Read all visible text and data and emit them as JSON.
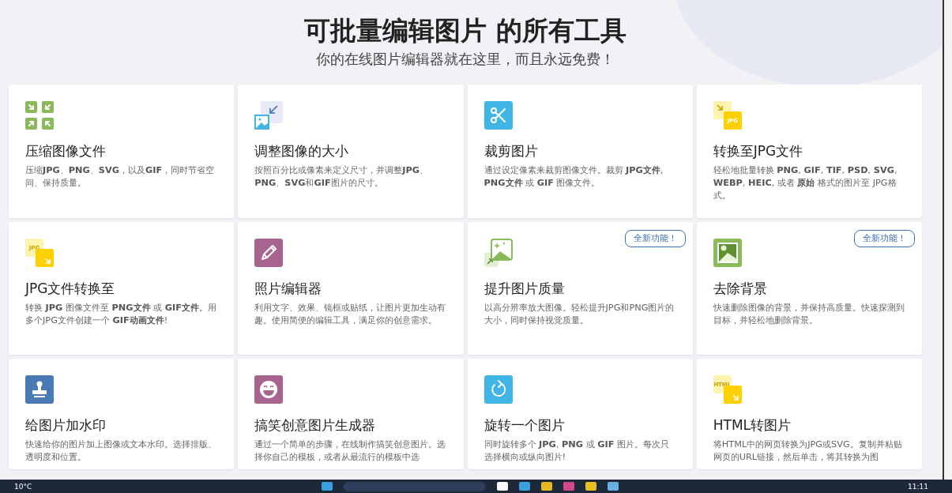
{
  "header": {
    "title": "可批量编辑图片 的所有工具",
    "subtitle": "你的在线图片编辑器就在这里，而且永远免费！"
  },
  "tools": [
    {
      "kind": "compress",
      "title": "压缩图像文件",
      "description": "压缩**JPG**、**PNG**、**SVG**，以及**GIF**，同时节省空间、保持质量。"
    },
    {
      "kind": "resize",
      "title": "调整图像的大小",
      "description": "按照百分比或像素来定义尺寸，并调整**JPG**、**PNG**、**SVG**和**GIF**图片的尺寸。"
    },
    {
      "kind": "crop",
      "title": "裁剪图片",
      "description": "通过设定像素来裁剪图像文件。裁剪 **JPG文件**, **PNG文件** 或 **GIF** 图像文件。"
    },
    {
      "kind": "convert_to",
      "icon_label": "JPG",
      "title": "转换至JPG文件",
      "description": "轻松地批量转换 **PNG**, **GIF**, **TIF**, **PSD**, **SVG**, **WEBP**, **HEIC**, 或者 **原始** 格式的图片至 JPG格式。"
    },
    {
      "kind": "convert_from",
      "icon_label": "JPG",
      "title": "JPG文件转换至",
      "description": "转换 **JPG** 图像文件至 **PNG文件** 或 **GIF文件**。用多个JPG文件创建一个 **GIF动画文件**!"
    },
    {
      "kind": "editor",
      "title": "照片编辑器",
      "description": "利用文字、效果、镜框或贴纸，让图片更加生动有趣。使用简便的编辑工具，满足你的创意需求。"
    },
    {
      "kind": "upscale",
      "badge": "全新功能！",
      "title": "提升图片质量",
      "description": "以高分辨率放大图像。轻松提升JPG和PNG图片的大小，同时保持视觉质量。"
    },
    {
      "kind": "remove_bg",
      "badge": "全新功能！",
      "title": "去除背景",
      "description": "快速删除图像的背景，并保持高质量。快速探测到目标，并轻松地删除背景。"
    },
    {
      "kind": "watermark",
      "title": "给图片加水印",
      "description": "快速给你的图片加上图像或文本水印。选择排版、透明度和位置。"
    },
    {
      "kind": "meme",
      "title": "搞笑创意图片生成器",
      "description": "通过一个简单的步骤，在线制作搞笑创意图片。选择你自己的模板，或者从最流行的模板中选"
    },
    {
      "kind": "rotate",
      "title": "旋转一个图片",
      "description": "同时旋转多个 **JPG**, **PNG** 或 **GIF** 图片。每次只选择横向或纵向图片!"
    },
    {
      "kind": "convert_from",
      "icon_label": "HTML",
      "title": "HTML转图片",
      "description": "将HTML中的网页转换为JPG或SVG。复制并粘贴网页的URL链接，然后单击，将其转换为图"
    }
  ],
  "taskbar": {
    "weather": "10°C",
    "clock": "11:11"
  }
}
